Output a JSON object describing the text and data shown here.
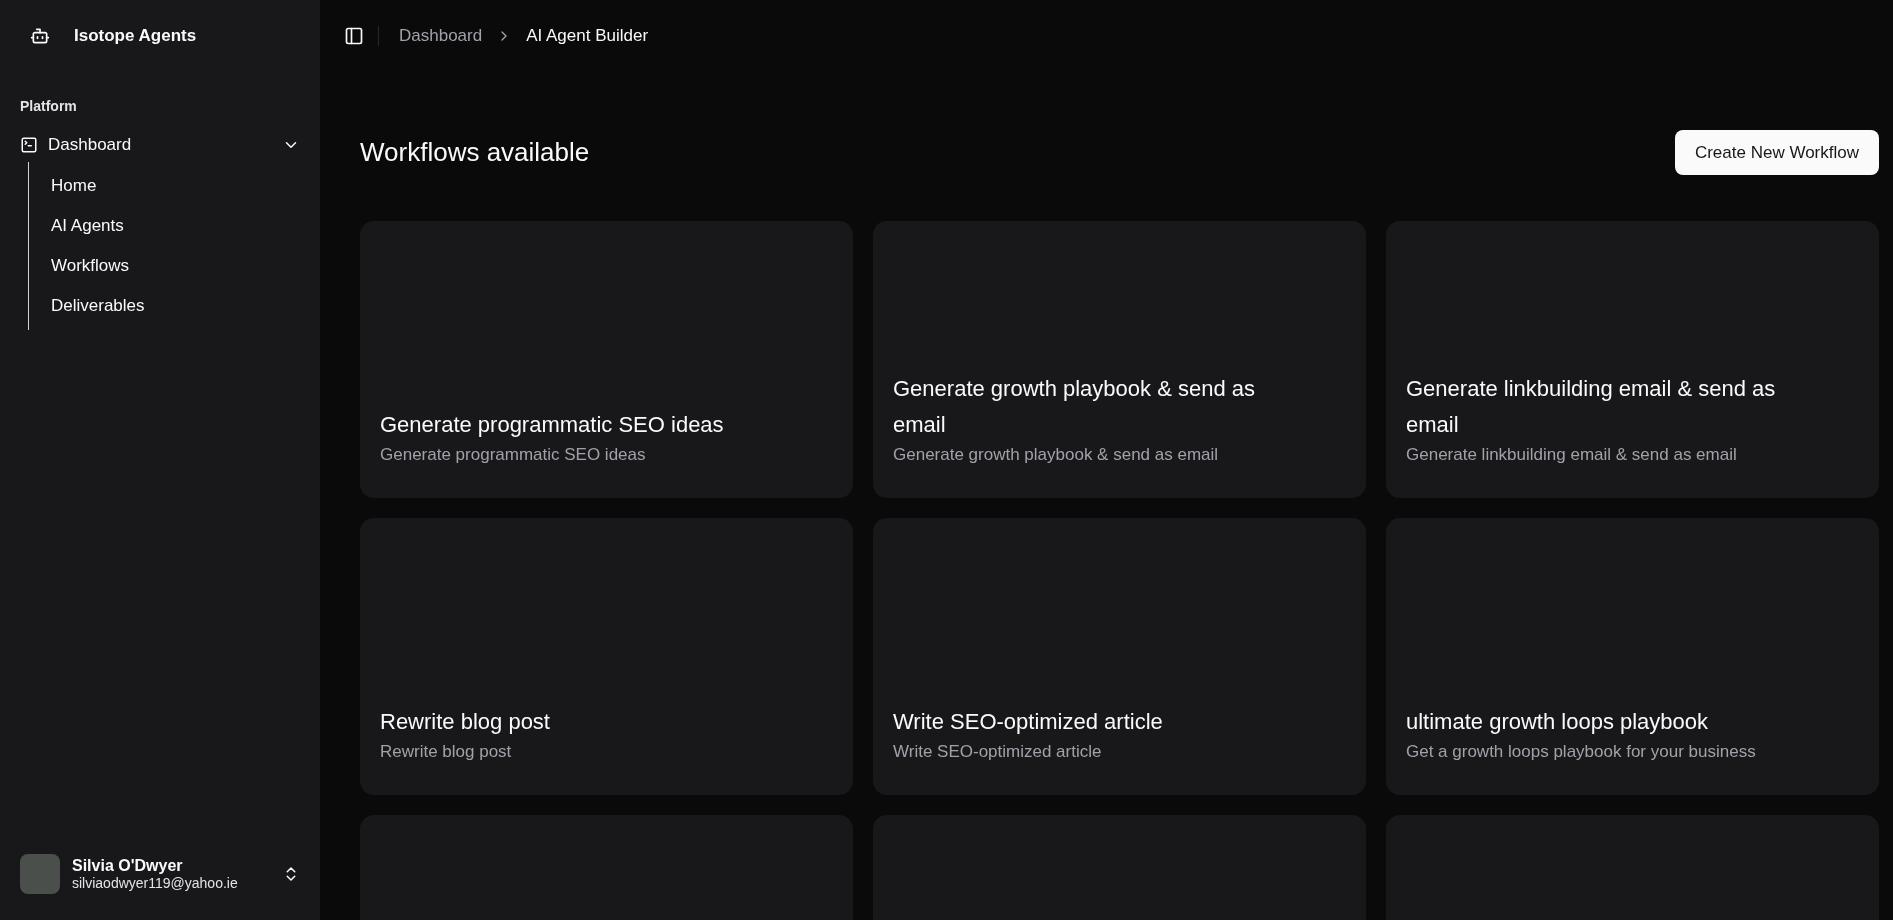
{
  "sidebar": {
    "brand": "Isotope Agents",
    "group_label": "Platform",
    "nav": [
      {
        "label": "Dashboard",
        "expanded": true,
        "children": [
          {
            "label": "Home"
          },
          {
            "label": "AI Agents"
          },
          {
            "label": "Workflows"
          },
          {
            "label": "Deliverables"
          }
        ]
      }
    ],
    "user": {
      "name": "Silvia O'Dwyer",
      "email": "silviaodwyer119@yahoo.ie"
    }
  },
  "breadcrumb": [
    {
      "label": "Dashboard",
      "current": false
    },
    {
      "label": "AI Agent Builder",
      "current": true
    }
  ],
  "page": {
    "title": "Workflows available",
    "action": "Create New Workflow"
  },
  "cards": [
    {
      "kind": "workflow",
      "title": "Generate programmatic SEO ideas",
      "description": "Generate programmatic SEO ideas"
    },
    {
      "kind": "workflow",
      "title": "Generate growth playbook & send as email",
      "description": "Generate growth playbook & send as email"
    },
    {
      "kind": "workflow",
      "title": "Generate linkbuilding email & send as email",
      "description": "Generate linkbuilding email & send as email"
    },
    {
      "kind": "workflow",
      "title": "Rewrite blog post",
      "description": "Rewrite blog post"
    },
    {
      "kind": "workflow",
      "title": "Write SEO-optimized article",
      "description": "Write SEO-optimized article"
    },
    {
      "kind": "workflow",
      "title": "ultimate growth loops playbook",
      "description": "Get a growth loops playbook for your business"
    },
    {
      "kind": "cut-off"
    },
    {
      "kind": "cut-off"
    },
    {
      "kind": "cut-off"
    }
  ]
}
